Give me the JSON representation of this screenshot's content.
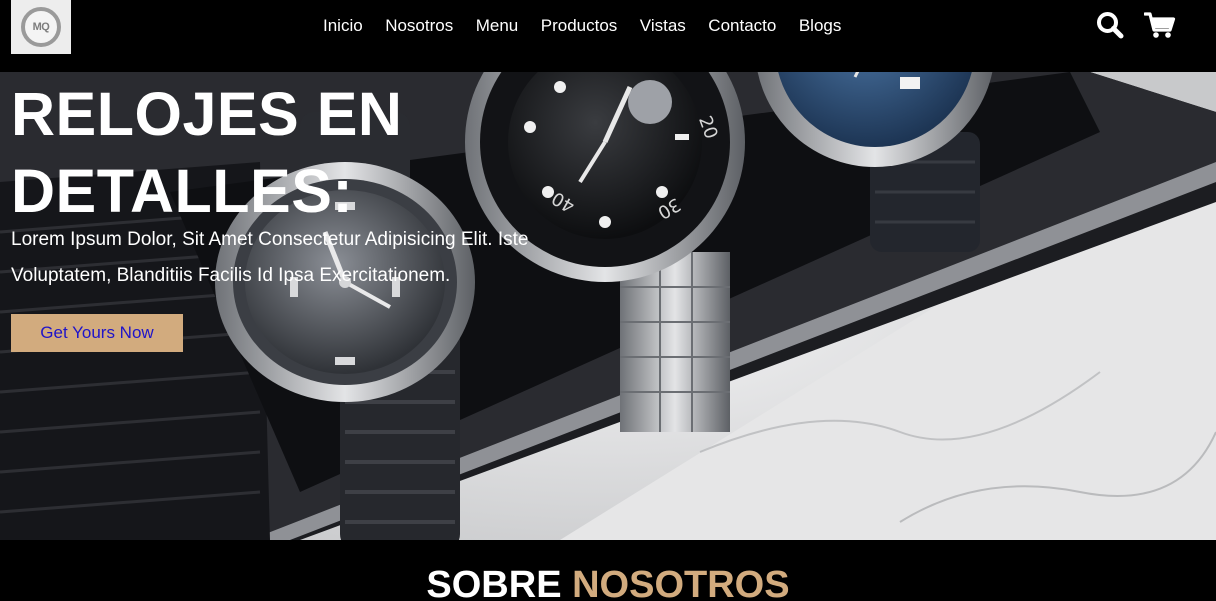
{
  "header": {
    "logo_text": "MQ",
    "nav": [
      "Inicio",
      "Nosotros",
      "Menu",
      "Productos",
      "Vistas",
      "Contacto",
      "Blogs"
    ],
    "icons": [
      "search-icon",
      "cart-icon"
    ]
  },
  "hero": {
    "title": "RELOJES EN DETALLES:",
    "description": "Lorem Ipsum Dolor, Sit Amet Consectetur Adipisicing Elit. Iste Voluptatem, Blanditiis Facilis Id Ipsa Exercitationem.",
    "cta_label": "Get Yours Now",
    "bezel_numerals": [
      "20",
      "30",
      "40"
    ]
  },
  "about": {
    "heading_part1": "SOBRE",
    "heading_part2": "NOSOTROS"
  },
  "colors": {
    "accent": "#d2ab7e",
    "button_text": "#1f14c9",
    "background": "#000000",
    "text": "#ffffff"
  }
}
